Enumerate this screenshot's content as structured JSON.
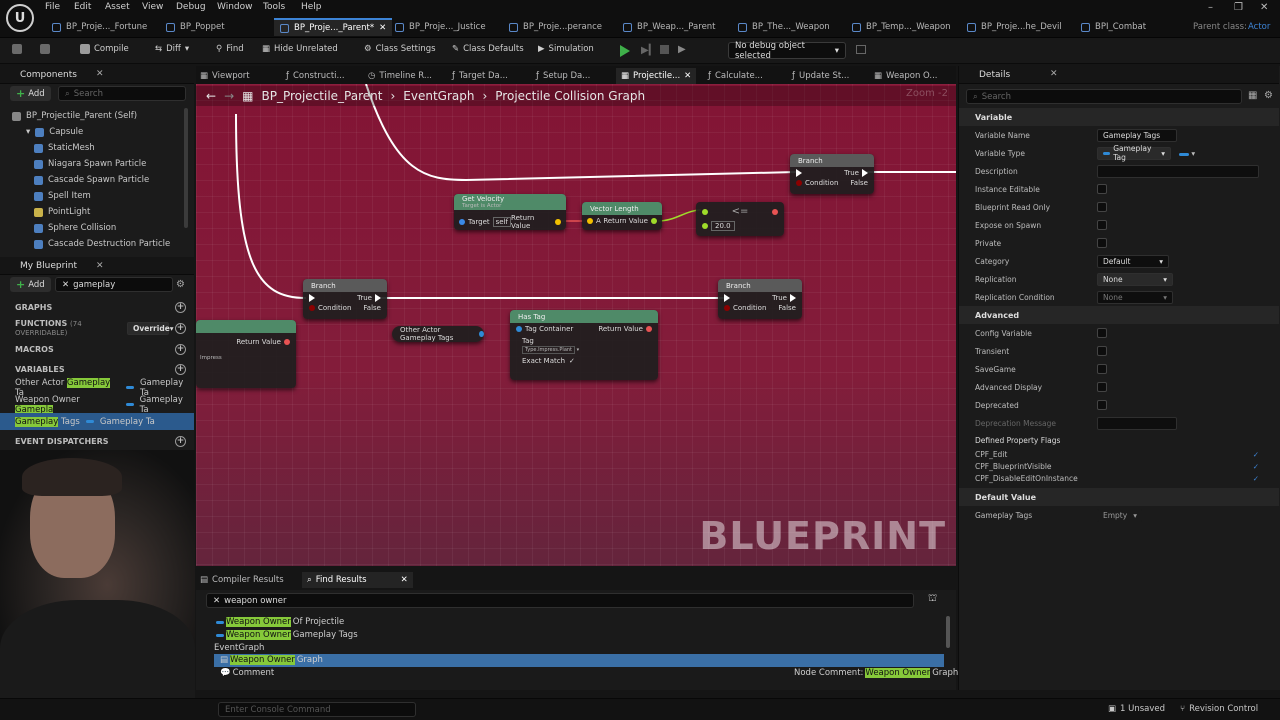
{
  "app": {
    "menu": [
      "File",
      "Edit",
      "Asset",
      "View",
      "Debug",
      "Window",
      "Tools",
      "Help"
    ],
    "tabs": [
      "BP_Proje..._Fortune",
      "BP_Poppet",
      "BP_Proje..._Parent*",
      "BP_Proje..._Justice",
      "BP_Proje...perance",
      "BP_Weap..._Parent",
      "BP_The..._Weapon",
      "BP_Temp..._Weapon",
      "BP_Proje...he_Devil",
      "BPI_Combat"
    ],
    "parent_class_label": "Parent class:",
    "parent_class_value": "Actor"
  },
  "toolbar": {
    "compile": "Compile",
    "diff": "Diff",
    "find": "Find",
    "hide_unrelated": "Hide Unrelated",
    "class_settings": "Class Settings",
    "class_defaults": "Class Defaults",
    "simulation": "Simulation",
    "debug_object": "No debug object selected"
  },
  "components": {
    "title": "Components",
    "add": "Add",
    "search_placeholder": "Search",
    "root": "BP_Projectile_Parent (Self)",
    "items": [
      "Capsule",
      "StaticMesh",
      "Niagara Spawn Particle",
      "Cascade Spawn Particle",
      "Spell Item",
      "PointLight",
      "Sphere Collision",
      "Cascade Destruction Particle"
    ]
  },
  "my_blueprint": {
    "title": "My Blueprint",
    "add": "Add",
    "search_value": "gameplay",
    "graphs": "GRAPHS",
    "functions": "FUNCTIONS",
    "functions_count": "(74 OVERRIDABLE)",
    "override": "Override",
    "macros": "MACROS",
    "variables": "VARIABLES",
    "event_dispatchers": "EVENT DISPATCHERS",
    "vars": [
      {
        "pre": "Other Actor ",
        "hl": "Gameplay",
        "post": " Ta",
        "type": "Gameplay Ta"
      },
      {
        "pre": "Weapon Owner ",
        "hl": "Gamepla",
        "post": "",
        "type": "Gameplay Ta"
      },
      {
        "pre": "",
        "hl": "Gameplay",
        "post": " Tags",
        "type": "Gameplay Ta"
      }
    ]
  },
  "graph": {
    "tabs": [
      "Viewport",
      "Constructi...",
      "Timeline R...",
      "Target Da...",
      "Setup Da...",
      "Projectile...",
      "Calculate...",
      "Update St...",
      "Weapon O..."
    ],
    "crumb_root": "BP_Projectile_Parent",
    "crumb_mid": "EventGraph",
    "crumb_leaf": "Projectile Collision Graph",
    "zoom": "Zoom -2",
    "watermark": "BLUEPRINT",
    "nodes": {
      "branch1": {
        "title": "Branch",
        "condition": "Condition",
        "true": "True",
        "false": "False"
      },
      "branch2": {
        "title": "Branch",
        "condition": "Condition",
        "true": "True",
        "false": "False"
      },
      "branch3": {
        "title": "Branch",
        "condition": "Condition",
        "true": "True",
        "false": "False"
      },
      "velocity": {
        "title": "Get Velocity",
        "sub": "Target is Actor",
        "target": "Target",
        "self": "self",
        "ret": "Return Value"
      },
      "vlength": {
        "title": "Vector Length",
        "a": "A",
        "ret": "Return Value"
      },
      "compare": {
        "op": "<=",
        "value": "20.0"
      },
      "hastag": {
        "title": "Has Tag",
        "tc": "Tag Container",
        "tag": "Tag",
        "tagval": "Type.Impress.Plant",
        "ret": "Return Value",
        "exact": "Exact Match"
      },
      "leftnode": {
        "ret": "Return Value",
        "val": "Impress"
      },
      "other_actor_tags": "Other Actor Gameplay Tags"
    }
  },
  "bottom": {
    "tabs": [
      "Compiler Results",
      "Find Results"
    ],
    "search_value": "weapon owner",
    "results": [
      {
        "hl": "Weapon Owner",
        "post": " Of Projectile",
        "indent": 1
      },
      {
        "hl": "Weapon Owner",
        "post": " Gameplay Tags",
        "indent": 1
      },
      {
        "hl": "",
        "post": "EventGraph",
        "indent": 0
      },
      {
        "hl": "Weapon Owner",
        "post": " Graph",
        "indent": 1,
        "selected": true
      },
      {
        "hl": "",
        "post": "Comment",
        "indent": 1
      }
    ],
    "node_comment_label": "Node Comment:",
    "node_comment_hl": "Weapon Owner",
    "node_comment_post": " Graph",
    "console_placeholder": "Enter Console Command"
  },
  "details": {
    "title": "Details",
    "search_placeholder": "Search",
    "sections": {
      "variable": "Variable",
      "advanced": "Advanced",
      "default_value": "Default Value"
    },
    "variable_name_label": "Variable Name",
    "variable_name": "Gameplay Tags",
    "variable_type_label": "Variable Type",
    "variable_type": "Gameplay Tag",
    "description_label": "Description",
    "instance_editable": "Instance Editable",
    "bp_readonly": "Blueprint Read Only",
    "expose_spawn": "Expose on Spawn",
    "private": "Private",
    "category_label": "Category",
    "category": "Default",
    "replication_label": "Replication",
    "replication": "None",
    "replication_cond_label": "Replication Condition",
    "replication_cond": "None",
    "config_var": "Config Variable",
    "transient": "Transient",
    "savegame": "SaveGame",
    "adv_display": "Advanced Display",
    "deprecated": "Deprecated",
    "deprecation_msg": "Deprecation Message",
    "flags_title": "Defined Property Flags",
    "flags": [
      "CPF_Edit",
      "CPF_BlueprintVisible",
      "CPF_DisableEditOnInstance"
    ],
    "default_gameplay_tags": "Gameplay Tags",
    "default_value": "Empty"
  },
  "status": {
    "unsaved": "1 Unsaved",
    "revision": "Revision Control"
  }
}
